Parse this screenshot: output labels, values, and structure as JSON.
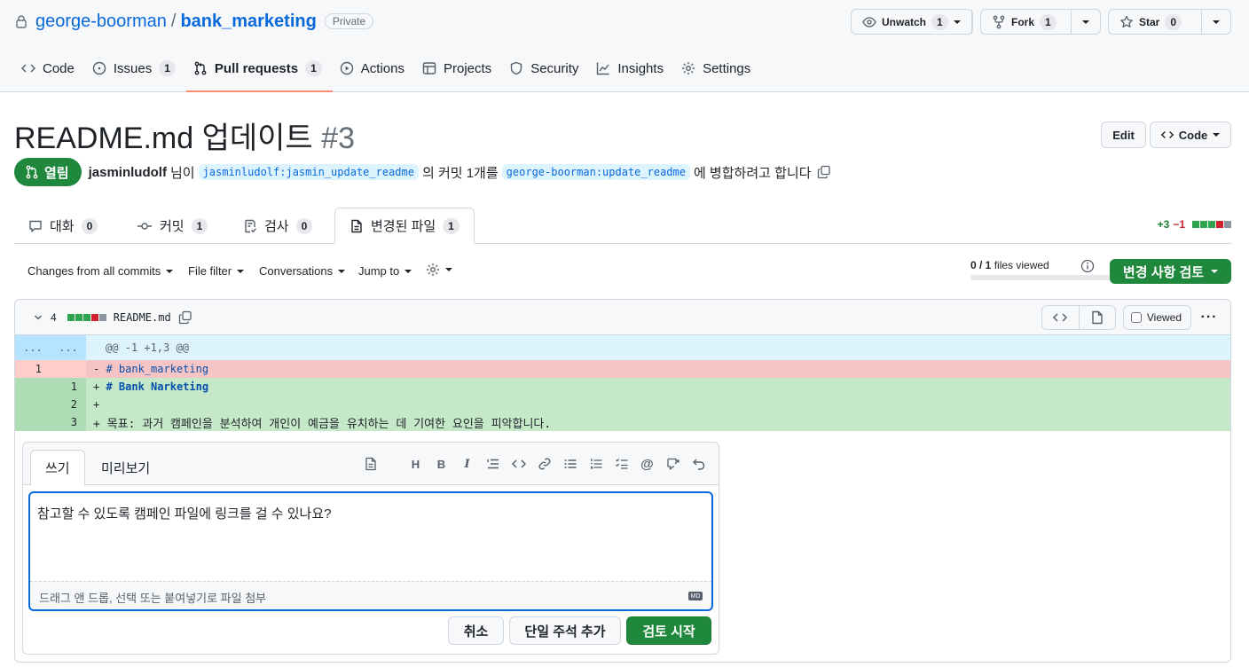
{
  "repo": {
    "owner": "george-boorman",
    "separator": "/",
    "name": "bank_marketing",
    "visibility": "Private"
  },
  "repo_actions": {
    "unwatch": {
      "label": "Unwatch",
      "count": "1"
    },
    "fork": {
      "label": "Fork",
      "count": "1"
    },
    "star": {
      "label": "Star",
      "count": "0"
    }
  },
  "nav": {
    "code": "Code",
    "issues": "Issues",
    "issues_count": "1",
    "pulls": "Pull requests",
    "pulls_count": "1",
    "actions": "Actions",
    "projects": "Projects",
    "security": "Security",
    "insights": "Insights",
    "settings": "Settings"
  },
  "pr": {
    "title": "README.md 업데이트",
    "number": "#3",
    "edit_label": "Edit",
    "code_label": "Code",
    "state": "열림",
    "author": "jasminludolf",
    "text1": "님이",
    "head_branch": "jasminludolf:jasmin_update_readme",
    "text2": "의 커밋 1개를",
    "base_branch": "george-boorman:update_readme",
    "text3": "에 병합하려고 합니다"
  },
  "tabs": {
    "conversation": {
      "label": "대화",
      "count": "0"
    },
    "commits": {
      "label": "커밋",
      "count": "1"
    },
    "checks": {
      "label": "검사",
      "count": "0"
    },
    "files": {
      "label": "변경된 파일",
      "count": "1"
    }
  },
  "diffstat": {
    "additions": "+3",
    "deletions": "−1"
  },
  "toolbar": {
    "changes": "Changes from all commits",
    "file_filter": "File filter",
    "conversations": "Conversations",
    "jump_to": "Jump to",
    "files_viewed_count": "0 / 1",
    "files_viewed_label": "files viewed",
    "files_viewed_fraction": 0,
    "review_button": "변경 사항 검토"
  },
  "file": {
    "changes": "4",
    "name": "README.md",
    "viewed_label": "Viewed",
    "hunk_left": "...",
    "hunk_right": "...",
    "hunk": "@@ -1 +1,3 @@",
    "lines": [
      {
        "type": "del",
        "old": "1",
        "new": "",
        "sign": "-",
        "text": "# bank_marketing"
      },
      {
        "type": "add",
        "old": "",
        "new": "1",
        "sign": "+",
        "text": "# Bank Narketing"
      },
      {
        "type": "add",
        "old": "",
        "new": "2",
        "sign": "+",
        "text": ""
      },
      {
        "type": "add",
        "old": "",
        "new": "3",
        "sign": "+",
        "text": "목표: 과거 캠페인을 분석하여 개인이 예금을 유치하는 데 기여한 요인을 피악합니다."
      }
    ]
  },
  "comment": {
    "tab_write": "쓰기",
    "tab_preview": "미리보기",
    "text": "참고할 수 있도록 캠페인 파일에 링크를 걸 수 있나요?",
    "attach_hint": "드래그 앤 드롭, 선택 또는 붙여넣기로 파일 첨부",
    "md_badge": "MD",
    "cancel": "취소",
    "single_comment": "단일 주석 추가",
    "start_review": "검토 시작"
  },
  "colors": {
    "accent": "#0969da",
    "success": "#1f883d",
    "danger": "#cf222e",
    "tab_underline": "#fd8c73"
  }
}
